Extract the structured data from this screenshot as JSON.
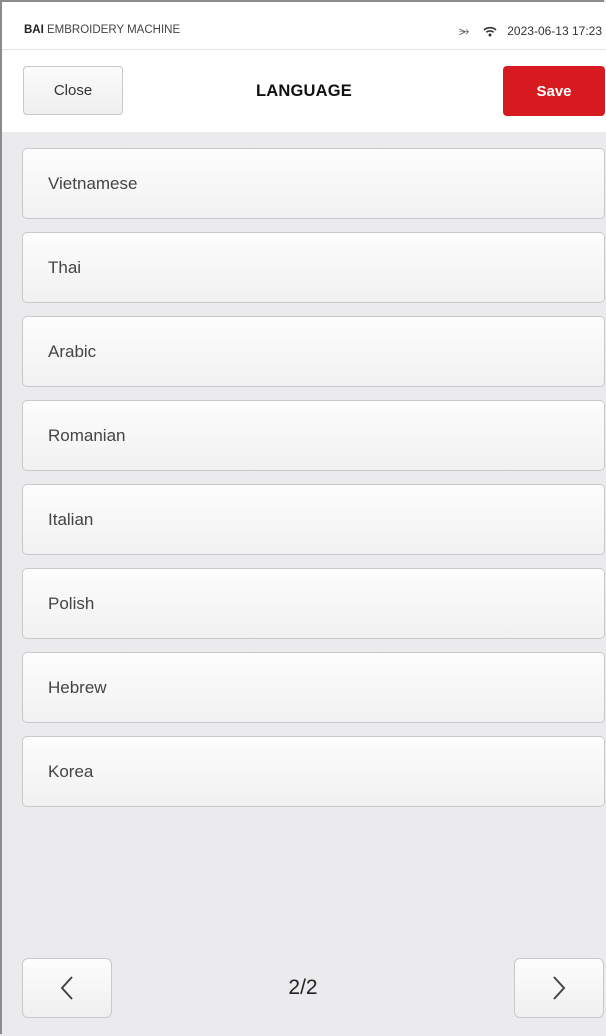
{
  "statusbar": {
    "brand_bold": "BAI",
    "brand_rest": " EMBROIDERY MACHINE",
    "usb_icon": "usb-icon",
    "wifi_icon": "wifi-icon",
    "datetime": "2023-06-13 17:23"
  },
  "header": {
    "close_label": "Close",
    "title": "LANGUAGE",
    "save_label": "Save",
    "save_color": "#d71a1f"
  },
  "languages": [
    "Vietnamese",
    "Thai",
    "Arabic",
    "Romanian",
    "Italian",
    "Polish",
    "Hebrew",
    "Korea"
  ],
  "pager": {
    "indicator": "2/2",
    "prev_icon": "chevron-left-icon",
    "next_icon": "chevron-right-icon"
  }
}
